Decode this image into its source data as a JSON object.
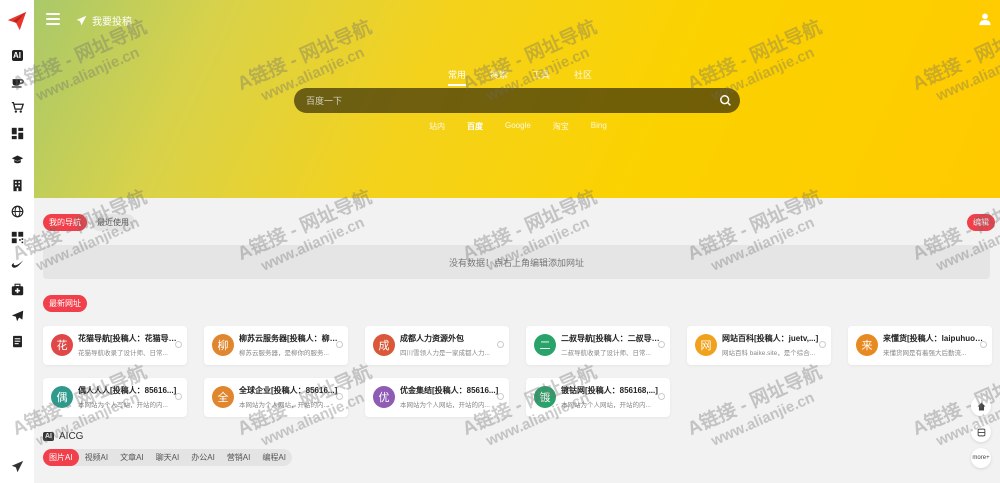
{
  "sidebar": {
    "items": [
      {
        "name": "ai-icon",
        "label": "AI"
      },
      {
        "name": "coffee-icon"
      },
      {
        "name": "cart-icon"
      },
      {
        "name": "grid-icon"
      },
      {
        "name": "graduation-cap-icon"
      },
      {
        "name": "building-icon"
      },
      {
        "name": "globe-icon"
      },
      {
        "name": "qrcode-icon"
      },
      {
        "name": "swoosh-icon"
      },
      {
        "name": "medkit-icon"
      },
      {
        "name": "plane-icon"
      },
      {
        "name": "document-icon"
      },
      {
        "name": "send-icon"
      }
    ]
  },
  "header": {
    "submit_label": "我要投稿"
  },
  "search": {
    "tabs": [
      "常用",
      "搜索",
      "工具",
      "社区"
    ],
    "active_tab": "常用",
    "placeholder": "百度一下",
    "engines": [
      "站内",
      "百度",
      "Google",
      "淘宝",
      "Bing"
    ],
    "active_engine": "百度"
  },
  "favorites": {
    "tabs": [
      "我的导航",
      "最近使用"
    ],
    "edit_label": "编辑",
    "empty_text": "没有数据！点右上角编辑添加网址"
  },
  "latest": {
    "tab_label": "最新网址",
    "cards": [
      {
        "avatar": "花",
        "color": "#e04848",
        "title": "花猫导航[投稿人：花猫导航]",
        "desc": "花猫导航收录了设计师、日常..."
      },
      {
        "avatar": "柳",
        "color": "#e0862e",
        "title": "柳苏云服务器[投稿人：柳苏云]",
        "desc": "柳苏云服务器，是柳你的服务..."
      },
      {
        "avatar": "成",
        "color": "#d9583a",
        "title": "成都人力资源外包",
        "desc": "四川雪领人力是一家成都人力..."
      },
      {
        "avatar": "二",
        "color": "#2aa36b",
        "title": "二叔导航[投稿人：二叔导航]",
        "desc": "二叔导航收录了设计师、日常..."
      },
      {
        "avatar": "网",
        "color": "#f0a21d",
        "title": "网站百科[投稿人：juetv,...]",
        "desc": "网站百科 baike.site，是个综合..."
      },
      {
        "avatar": "来",
        "color": "#e88a22",
        "title": "来懂货[投稿人：laipuhuo...]",
        "desc": "来懂货网是有着强大后勤流..."
      },
      {
        "avatar": "偶",
        "color": "#2f9a8c",
        "title": "偶人人人[投稿人：85616...]",
        "desc": "本网站为个人写站，开站的内..."
      },
      {
        "avatar": "全",
        "color": "#e0862e",
        "title": "全球企业[投稿人：85616...]",
        "desc": "本网站为个人网站，开站的内..."
      },
      {
        "avatar": "优",
        "color": "#8e5bb5",
        "title": "优金集结[投稿人：85616...]",
        "desc": "本网站为个人网站，开站的内..."
      },
      {
        "avatar": "镀",
        "color": "#2aa36b",
        "title": "镀钴网[投稿人：856168,...]",
        "desc": "本网站为个人网站，开站的内..."
      }
    ]
  },
  "aicg": {
    "badge": "AI",
    "title": "AICG",
    "tabs": [
      "图片AI",
      "视频AI",
      "文章AI",
      "聊天AI",
      "办公AI",
      "营销AI",
      "编程AI"
    ],
    "active_tab": "图片AI"
  },
  "float": {
    "more_label": "more+"
  },
  "watermark": {
    "line1": "A链接 - 网址导航",
    "line2": "www.alianjie.cn"
  },
  "colors": {
    "accent": "#f1404b",
    "hero_yellow": "#fbd200"
  }
}
